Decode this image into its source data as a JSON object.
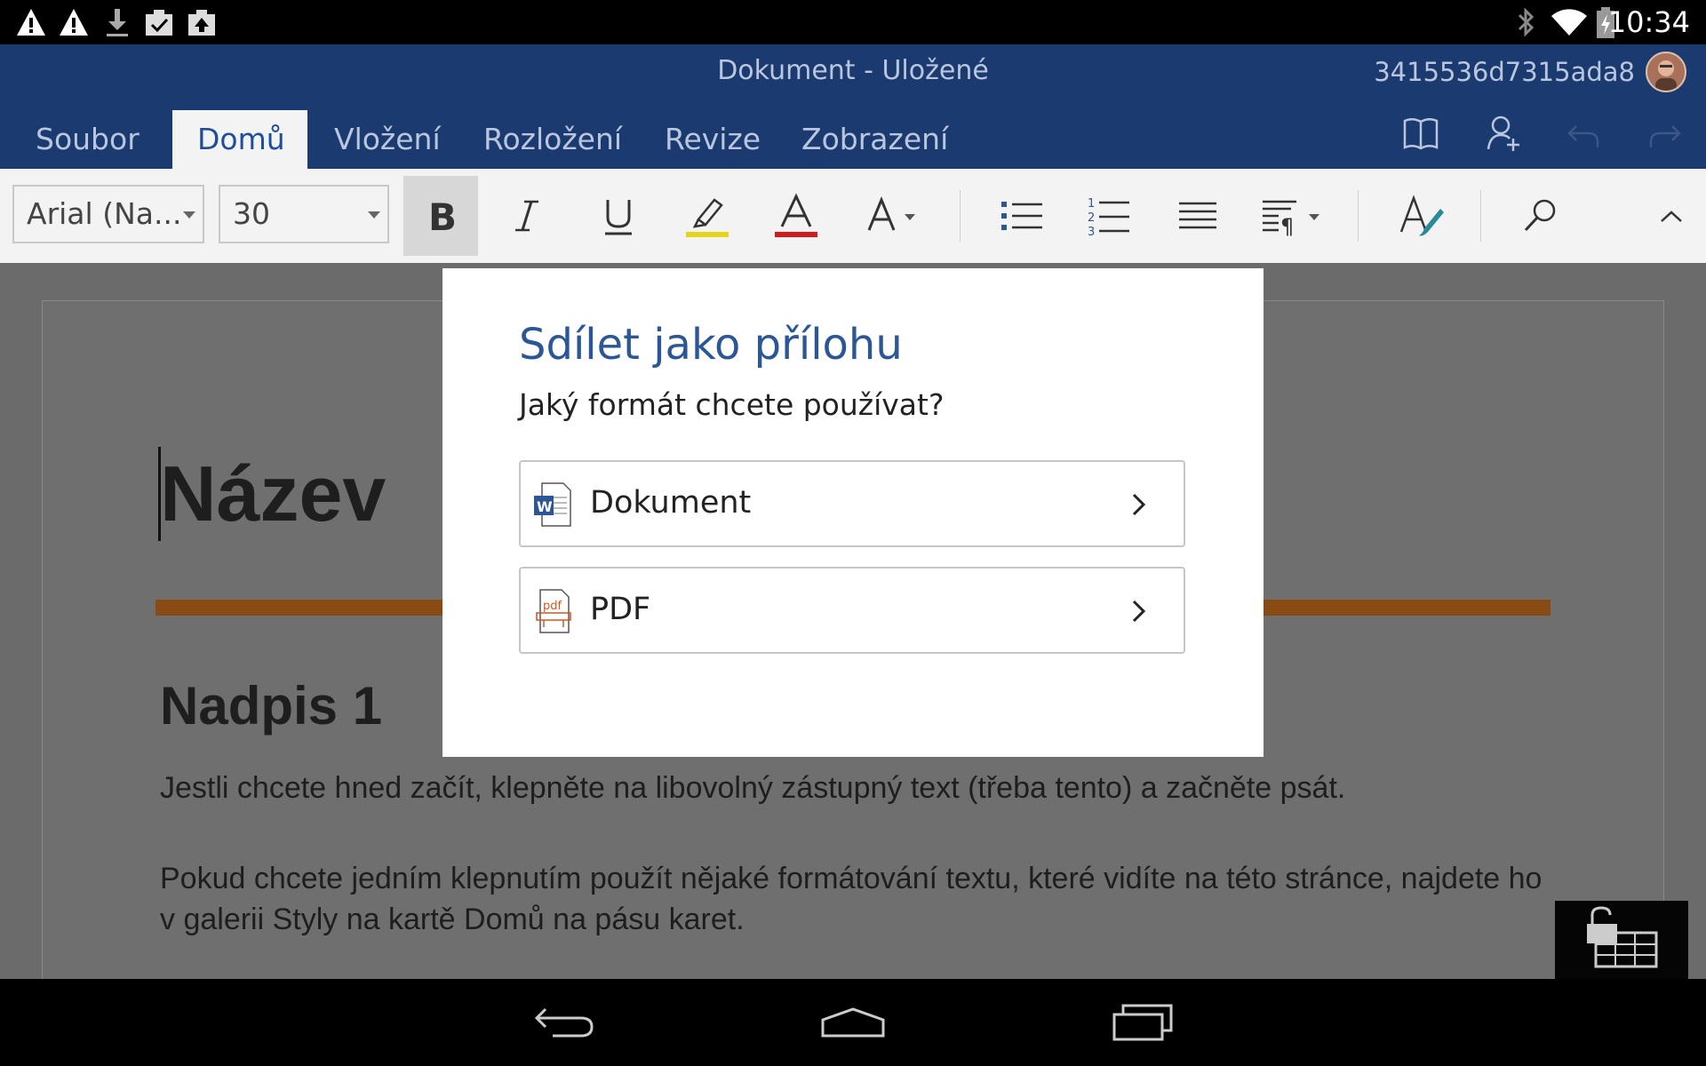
{
  "status_bar": {
    "time": "10:34",
    "left_icons": [
      "warning-icon",
      "warning-icon",
      "download-icon",
      "clipboard-check-icon",
      "clipboard-upload-icon"
    ],
    "right_icons": [
      "bluetooth-icon",
      "wifi-icon",
      "battery-icon"
    ]
  },
  "header": {
    "doc_title": "Dokument - Uložené",
    "account_id": "3415536d7315ada8"
  },
  "ribbon": {
    "tabs": [
      {
        "label": "Soubor",
        "active": false
      },
      {
        "label": "Domů",
        "active": true
      },
      {
        "label": "Vložení",
        "active": false
      },
      {
        "label": "Rozložení",
        "active": false
      },
      {
        "label": "Revize",
        "active": false
      },
      {
        "label": "Zobrazení",
        "active": false
      }
    ]
  },
  "toolbar": {
    "font_name": "Arial (Na...",
    "font_size": "30"
  },
  "document": {
    "title": "Název",
    "heading1": "Nadpis 1",
    "para1": "Jestli chcete hned začít, klepněte na libovolný zástupný text (třeba tento) a začněte psát.",
    "para2": "Pokud chcete jedním klepnutím použít nějaké formátování textu, které vidíte na této stránce, najdete ho v galerii Styly na kartě Domů na pásu karet."
  },
  "dialog": {
    "title": "Sdílet jako přílohu",
    "subtitle": "Jaký formát chcete používat?",
    "options": [
      {
        "label": "Dokument",
        "icon": "word-document-icon"
      },
      {
        "label": "PDF",
        "icon": "pdf-document-icon"
      }
    ]
  },
  "colors": {
    "ribbon_bg": "#1b3a6f",
    "accent_blue": "#2b5797",
    "highlight_yellow": "#e8d41a",
    "font_color_red": "#d01c1c",
    "rule_orange": "#8a4a14"
  }
}
